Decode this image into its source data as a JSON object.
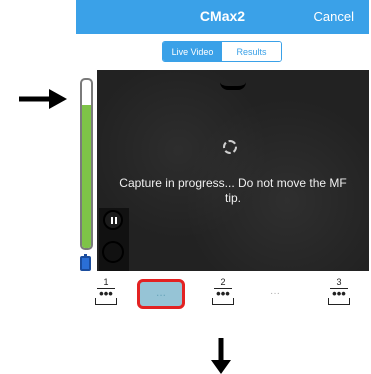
{
  "navbar": {
    "title": "CMax2",
    "cancel_label": "Cancel",
    "color": "#3aa1e8"
  },
  "segmented": {
    "live_label": "Live Video",
    "results_label": "Results",
    "selected": "Live Video"
  },
  "video": {
    "status_text": "Capture in progress... Do not move the MF tip."
  },
  "level_meter": {
    "fill_fraction": 0.85,
    "fill_color": "#7ec347"
  },
  "steps": {
    "step1": "1",
    "step2": "2",
    "step3": "3",
    "selected_label": "...",
    "ellipsis": "···"
  },
  "annotations": {
    "highlight_color": "#e32222"
  }
}
